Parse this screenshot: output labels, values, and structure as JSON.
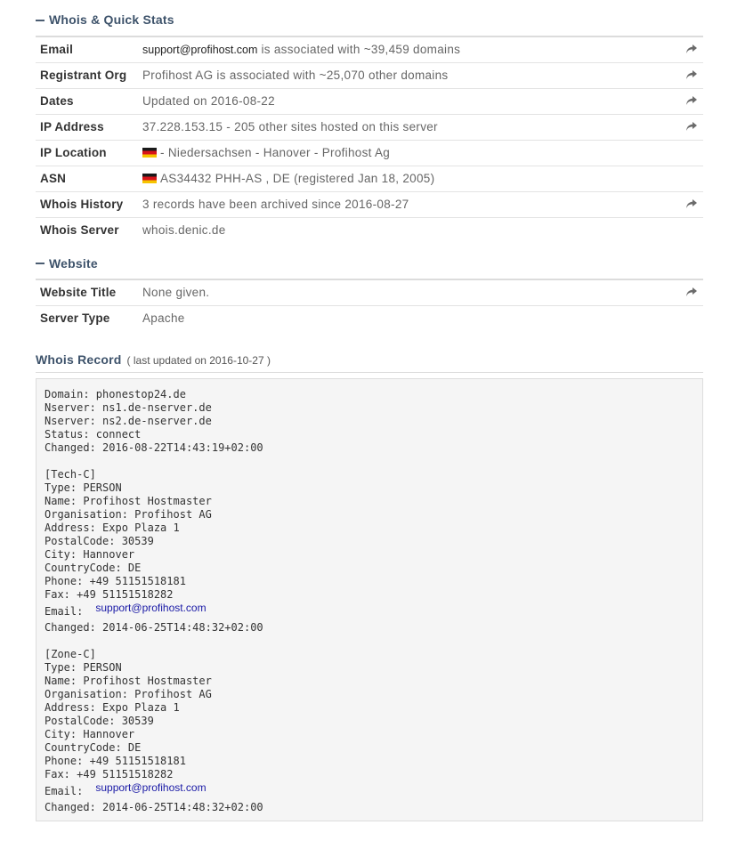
{
  "quick_stats": {
    "title": "Whois & Quick Stats",
    "rows": [
      {
        "label": "Email",
        "email": "support@profihost.com",
        "text": " is associated with ~39,459 domains",
        "share": true
      },
      {
        "label": "Registrant Org",
        "text": "Profihost AG is associated with ~25,070 other domains",
        "share": true
      },
      {
        "label": "Dates",
        "text": "Updated on 2016-08-22",
        "share": true
      },
      {
        "label": "IP Address",
        "text": "37.228.153.15 - 205 other sites hosted on this server",
        "share": true
      },
      {
        "label": "IP Location",
        "text": "- Niedersachsen - Hanover - Profihost Ag",
        "flag": "de-flag",
        "share": false
      },
      {
        "label": "ASN",
        "text": "AS34432 PHH-AS , DE (registered Jan 18, 2005)",
        "flag": "de-flag",
        "share": false
      },
      {
        "label": "Whois History",
        "text": "3 records have been archived since 2016-08-27",
        "share": true
      },
      {
        "label": "Whois Server",
        "text": "whois.denic.de",
        "share": false
      }
    ]
  },
  "website": {
    "title": "Website",
    "rows": [
      {
        "label": "Website Title",
        "text": "None given.",
        "share": true
      },
      {
        "label": "Server Type",
        "text": "Apache",
        "share": false
      }
    ]
  },
  "whois_record": {
    "title": "Whois Record",
    "subtitle": "( last updated on 2016-10-27 )",
    "blocks": [
      {
        "lines": [
          "Domain: phonestop24.de",
          "Nserver: ns1.de-nserver.de",
          "Nserver: ns2.de-nserver.de",
          "Status: connect",
          "Changed: 2016-08-22T14:43:19+02:00"
        ]
      },
      {
        "lines": [
          "[Tech-C]",
          "Type: PERSON",
          "Name: Profihost Hostmaster",
          "Organisation: Profihost AG",
          "Address: Expo Plaza 1",
          "PostalCode: 30539",
          "City: Hannover",
          "CountryCode: DE",
          "Phone: +49 51151518181",
          "Fax: +49 51151518282"
        ],
        "email_label": "Email:",
        "email": "support@profihost.com",
        "after": "Changed: 2014-06-25T14:48:32+02:00"
      },
      {
        "lines": [
          "[Zone-C]",
          "Type: PERSON",
          "Name: Profihost Hostmaster",
          "Organisation: Profihost AG",
          "Address: Expo Plaza 1",
          "PostalCode: 30539",
          "City: Hannover",
          "CountryCode: DE",
          "Phone: +49 51151518181",
          "Fax: +49 51151518282"
        ],
        "email_label": "Email:",
        "email": "support@profihost.com",
        "after": "Changed: 2014-06-25T14:48:32+02:00"
      }
    ]
  },
  "icons": {
    "share": "share-arrow-icon",
    "collapse": "minus-icon"
  },
  "colors": {
    "heading": "#3e536b",
    "link": "#1a1aa6",
    "record_bg": "#f5f5f5"
  }
}
